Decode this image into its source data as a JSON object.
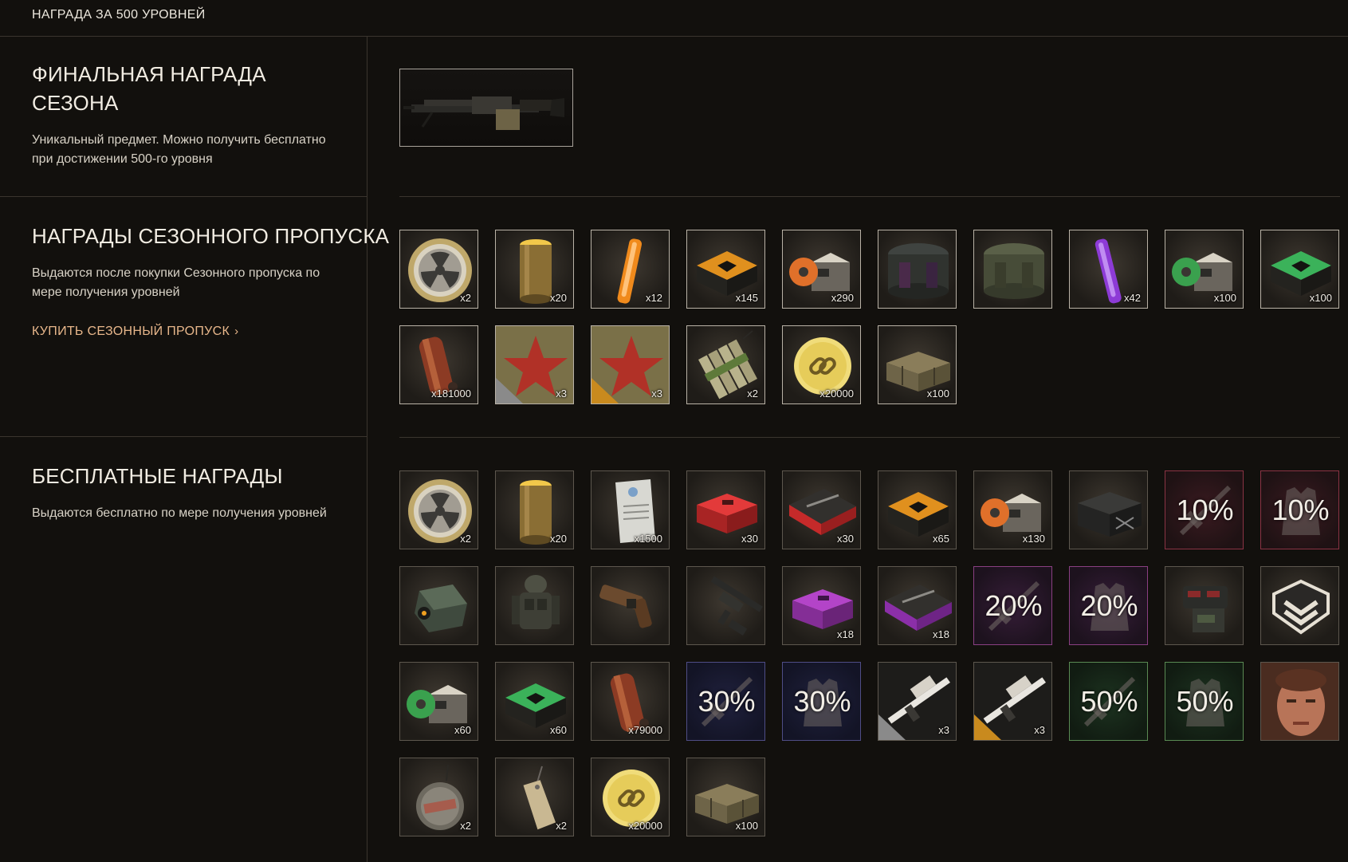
{
  "header": {
    "title": "НАГРАДА ЗА 500 УРОВНЕЙ"
  },
  "final": {
    "title_line1": "ФИНАЛЬНАЯ НАГРАДА",
    "title_line2": "СЕЗОНА",
    "desc_line1": "Уникальный предмет. Можно получить бесплатно",
    "desc_line2": "при достижении 500-го уровня"
  },
  "pass": {
    "title": "НАГРАДЫ СЕЗОННОГО ПРОПУСКА",
    "desc_line1": "Выдаются после покупки Сезонного пропуска по",
    "desc_line2": "мере получения уровней",
    "buy_label": "КУПИТЬ СЕЗОННЫЙ ПРОПУСК",
    "items": [
      {
        "name": "radiation-coin-icon",
        "qty": "x2"
      },
      {
        "name": "gold-canister-icon",
        "qty": "x20"
      },
      {
        "name": "orange-glowstick-icon",
        "qty": "x12"
      },
      {
        "name": "orange-ammo-box-icon",
        "qty": "x145"
      },
      {
        "name": "orange-tape-crate-icon",
        "qty": "x290"
      },
      {
        "name": "dark-pouch-icon",
        "qty": ""
      },
      {
        "name": "green-pouch-icon",
        "qty": ""
      },
      {
        "name": "purple-glowstick-icon",
        "qty": "x42"
      },
      {
        "name": "green-tape-crate-icon",
        "qty": "x100"
      },
      {
        "name": "green-ammo-box-icon",
        "qty": "x100"
      },
      {
        "name": "ammo-belt-icon",
        "qty": "x181000"
      },
      {
        "name": "camo-star-armor-icon",
        "qty": "x3"
      },
      {
        "name": "camo-star-weapon-icon",
        "qty": "x3"
      },
      {
        "name": "dynamite-icon",
        "qty": "x2"
      },
      {
        "name": "gold-chain-coin-icon",
        "qty": "x20000"
      },
      {
        "name": "wooden-crate-icon",
        "qty": "x100"
      }
    ]
  },
  "free": {
    "title": "БЕСПЛАТНЫЕ НАГРАДЫ",
    "desc": "Выдаются бесплатно по мере получения уровней",
    "items": [
      {
        "name": "radiation-coin-icon",
        "qty": "x2"
      },
      {
        "name": "gold-canister-icon",
        "qty": "x20"
      },
      {
        "name": "document-tag-icon",
        "qty": "x1500"
      },
      {
        "name": "red-medkit-icon",
        "qty": "x30"
      },
      {
        "name": "red-weapon-case-icon",
        "qty": "x30"
      },
      {
        "name": "orange-ammo-box-icon",
        "qty": "x65"
      },
      {
        "name": "orange-tape-crate-icon",
        "qty": "x130"
      },
      {
        "name": "black-supply-crate-icon",
        "qty": ""
      },
      {
        "name": "weapon-discount-icon",
        "pct": "10%"
      },
      {
        "name": "armor-discount-icon",
        "pct": "10%"
      },
      {
        "name": "grenade-device-icon",
        "qty": ""
      },
      {
        "name": "soldier-armor-icon",
        "qty": ""
      },
      {
        "name": "flare-gun-icon",
        "qty": ""
      },
      {
        "name": "rifle-icon",
        "qty": ""
      },
      {
        "name": "purple-medkit-icon",
        "qty": "x18"
      },
      {
        "name": "purple-weapon-case-icon",
        "qty": "x18"
      },
      {
        "name": "weapon-discount-icon",
        "pct": "20%"
      },
      {
        "name": "armor-discount-icon",
        "pct": "20%"
      },
      {
        "name": "tactical-belt-icon",
        "qty": ""
      },
      {
        "name": "rank-badge-icon",
        "qty": ""
      },
      {
        "name": "green-tape-crate-icon",
        "qty": "x60"
      },
      {
        "name": "green-ammo-box-icon",
        "qty": "x60"
      },
      {
        "name": "ammo-belt-icon",
        "qty": "x79000"
      },
      {
        "name": "weapon-discount-icon",
        "pct": "30%"
      },
      {
        "name": "armor-discount-icon",
        "pct": "30%"
      },
      {
        "name": "camo-sniper-armor-icon",
        "qty": "x3"
      },
      {
        "name": "camo-sniper-weapon-icon",
        "qty": "x3"
      },
      {
        "name": "weapon-discount-icon",
        "pct": "50%"
      },
      {
        "name": "armor-discount-icon",
        "pct": "50%"
      },
      {
        "name": "portrait-icon",
        "qty": ""
      },
      {
        "name": "secret-medal-icon",
        "qty": "x2"
      },
      {
        "name": "paper-tag-icon",
        "qty": "x2"
      },
      {
        "name": "gold-chain-coin-icon",
        "qty": "x20000"
      },
      {
        "name": "wooden-crate-icon",
        "qty": "x100"
      }
    ]
  },
  "final_item": {
    "name": "machine-gun-icon"
  }
}
